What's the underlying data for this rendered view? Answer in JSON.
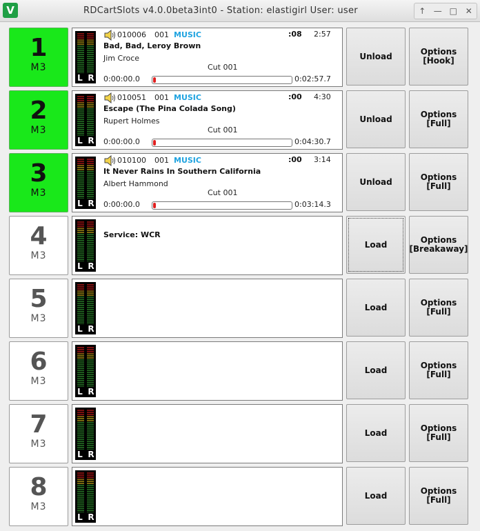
{
  "window": {
    "icon": "cart-app-icon",
    "title": "RDCartSlots v4.0.0beta3int0 - Station: elastigirl  User: user",
    "controls": [
      "↑",
      "—",
      "□",
      "✕"
    ]
  },
  "slots": [
    {
      "number": "1",
      "mode": "M3",
      "active": true,
      "cart": "010006",
      "cut": "001",
      "group": "MUSIC",
      "talk": ":08",
      "length": "2:57",
      "title": "Bad, Bad, Leroy Brown",
      "artist": "Jim Croce",
      "cut_label": "Cut 001",
      "position": "0:00:00.0",
      "remaining": "0:02:57.7",
      "progress": 0,
      "service": "",
      "load_label": "Unload",
      "options_label": "Options",
      "options_mode": "[Hook]",
      "loaded": true
    },
    {
      "number": "2",
      "mode": "M3",
      "active": true,
      "cart": "010051",
      "cut": "001",
      "group": "MUSIC",
      "talk": ":00",
      "length": "4:30",
      "title": "Escape (The Pina Colada Song)",
      "artist": "Rupert Holmes",
      "cut_label": "Cut 001",
      "position": "0:00:00.0",
      "remaining": "0:04:30.7",
      "progress": 0,
      "service": "",
      "load_label": "Unload",
      "options_label": "Options",
      "options_mode": "[Full]",
      "loaded": true
    },
    {
      "number": "3",
      "mode": "M3",
      "active": true,
      "cart": "010100",
      "cut": "001",
      "group": "MUSIC",
      "talk": ":00",
      "length": "3:14",
      "title": "It Never Rains In Southern California",
      "artist": "Albert Hammond",
      "cut_label": "Cut 001",
      "position": "0:00:00.0",
      "remaining": "0:03:14.3",
      "progress": 0,
      "service": "",
      "load_label": "Unload",
      "options_label": "Options",
      "options_mode": "[Full]",
      "loaded": true
    },
    {
      "number": "4",
      "mode": "M3",
      "active": false,
      "service": "Service: WCR",
      "load_label": "Load",
      "options_label": "Options",
      "options_mode": "[Breakaway]",
      "loaded": false
    },
    {
      "number": "5",
      "mode": "M3",
      "active": false,
      "service": "",
      "load_label": "Load",
      "options_label": "Options",
      "options_mode": "[Full]",
      "loaded": false
    },
    {
      "number": "6",
      "mode": "M3",
      "active": false,
      "service": "",
      "load_label": "Load",
      "options_label": "Options",
      "options_mode": "[Full]",
      "loaded": false
    },
    {
      "number": "7",
      "mode": "M3",
      "active": false,
      "service": "",
      "load_label": "Load",
      "options_label": "Options",
      "options_mode": "[Full]",
      "loaded": false
    },
    {
      "number": "8",
      "mode": "M3",
      "active": false,
      "service": "",
      "load_label": "Load",
      "options_label": "Options",
      "options_mode": "[Full]",
      "loaded": false
    }
  ],
  "meter_labels": {
    "left": "L",
    "right": "R"
  },
  "colors": {
    "active": "#19e81a",
    "group": "#1fa3e0",
    "progress": "#e02020"
  }
}
